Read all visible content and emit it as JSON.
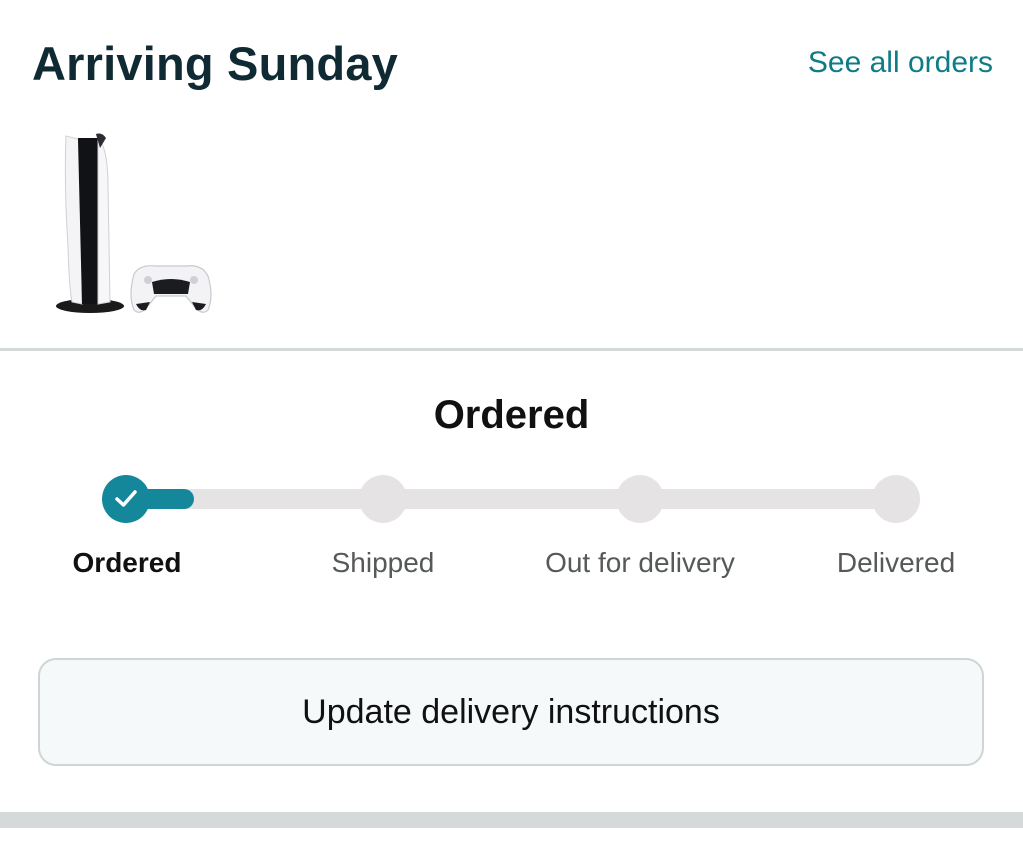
{
  "header": {
    "title": "Arriving Sunday",
    "see_all_label": "See all orders"
  },
  "product": {
    "image_icon": "ps5-console-with-controller"
  },
  "tracker": {
    "status_heading": "Ordered",
    "steps": [
      {
        "label": "Ordered",
        "state": "complete"
      },
      {
        "label": "Shipped",
        "state": "pending"
      },
      {
        "label": "Out for delivery",
        "state": "pending"
      },
      {
        "label": "Delivered",
        "state": "pending"
      }
    ],
    "progress_fraction": 0.09
  },
  "actions": {
    "update_instructions_label": "Update delivery instructions"
  },
  "colors": {
    "accent": "#14889a",
    "link": "#0e7c86",
    "title": "#0f2a33",
    "track": "#e6e3e4",
    "button_bg": "#f5f9fa",
    "divider": "#d5d9d9"
  }
}
